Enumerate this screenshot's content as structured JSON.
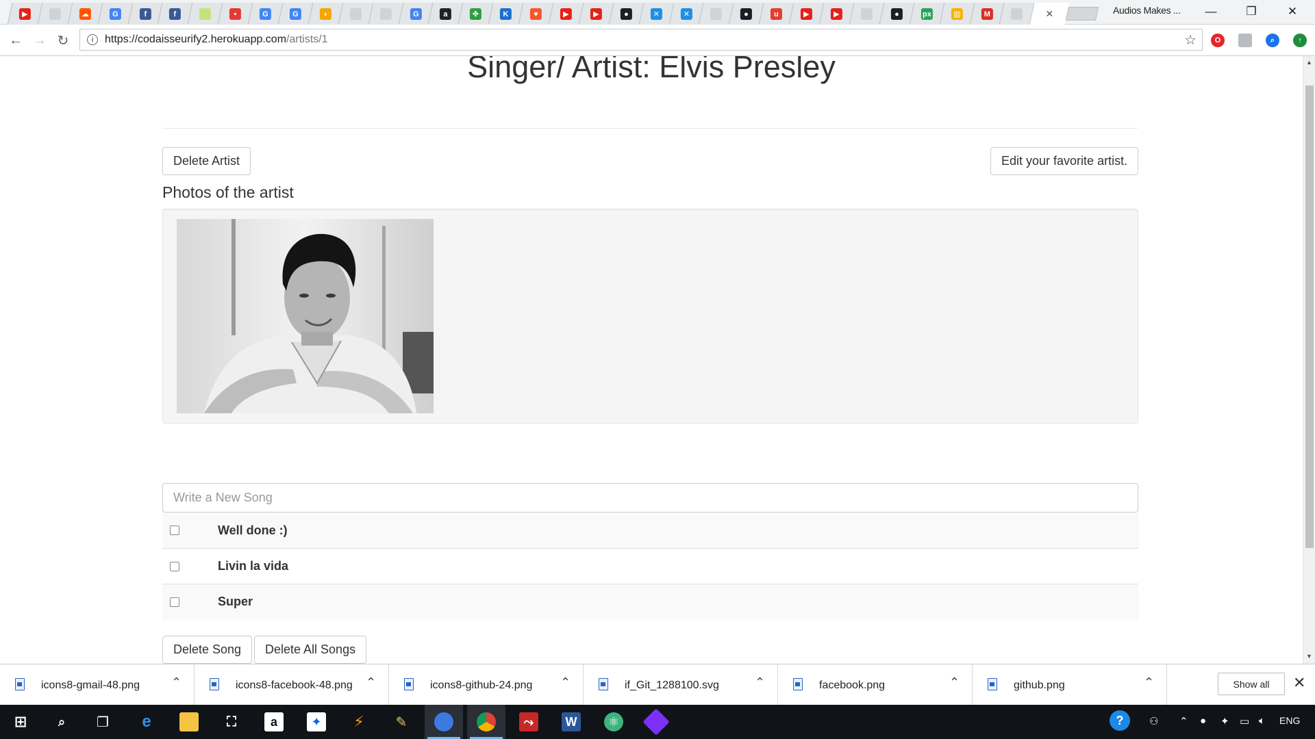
{
  "browser": {
    "tabs": [
      {
        "icon": "youtube-icon",
        "color": "#e62117",
        "glyph": "▶"
      },
      {
        "icon": "page-icon",
        "color": "#cfd3d6",
        "glyph": ""
      },
      {
        "icon": "soundcloud-icon",
        "color": "#ff5500",
        "glyph": "☁"
      },
      {
        "icon": "google-icon",
        "color": "#4285f4",
        "glyph": "G"
      },
      {
        "icon": "facebook-icon",
        "color": "#3b5998",
        "glyph": "f"
      },
      {
        "icon": "facebook-icon",
        "color": "#3b5998",
        "glyph": "f"
      },
      {
        "icon": "circle-icon",
        "color": "#c6e27a",
        "glyph": ""
      },
      {
        "icon": "record-icon",
        "color": "#e53935",
        "glyph": "•"
      },
      {
        "icon": "google-icon",
        "color": "#4285f4",
        "glyph": "G"
      },
      {
        "icon": "google-icon",
        "color": "#4285f4",
        "glyph": "G"
      },
      {
        "icon": "chromecast-icon",
        "color": "#f2a600",
        "glyph": "◗"
      },
      {
        "icon": "page-icon",
        "color": "#cfd3d6",
        "glyph": ""
      },
      {
        "icon": "page-icon",
        "color": "#cfd3d6",
        "glyph": ""
      },
      {
        "icon": "google-icon",
        "color": "#4285f4",
        "glyph": "G"
      },
      {
        "icon": "amazon-icon",
        "color": "#222222",
        "glyph": "a"
      },
      {
        "icon": "clover-icon",
        "color": "#2e9e44",
        "glyph": "✤"
      },
      {
        "icon": "k-icon",
        "color": "#1b6fd1",
        "glyph": "K"
      },
      {
        "icon": "brave-icon",
        "color": "#fb542b",
        "glyph": "♥"
      },
      {
        "icon": "youtube-icon",
        "color": "#e62117",
        "glyph": "▶"
      },
      {
        "icon": "youtube-icon",
        "color": "#e62117",
        "glyph": "▶"
      },
      {
        "icon": "github-icon",
        "color": "#1b1f23",
        "glyph": "●"
      },
      {
        "icon": "x-icon",
        "color": "#1f8fe6",
        "glyph": "✕"
      },
      {
        "icon": "x-icon",
        "color": "#1f8fe6",
        "glyph": "✕"
      },
      {
        "icon": "page-icon",
        "color": "#cfd3d6",
        "glyph": ""
      },
      {
        "icon": "github-icon",
        "color": "#1b1f23",
        "glyph": "●"
      },
      {
        "icon": "udemy-icon",
        "color": "#e63c2e",
        "glyph": "u"
      },
      {
        "icon": "youtube-icon",
        "color": "#e62117",
        "glyph": "▶"
      },
      {
        "icon": "youtube-icon",
        "color": "#e62117",
        "glyph": "▶"
      },
      {
        "icon": "page-icon",
        "color": "#cfd3d6",
        "glyph": ""
      },
      {
        "icon": "github-icon",
        "color": "#1b1f23",
        "glyph": "●"
      },
      {
        "icon": "px-icon",
        "color": "#29a35a",
        "glyph": "px"
      },
      {
        "icon": "bag-icon",
        "color": "#f5b400",
        "glyph": "▥"
      },
      {
        "icon": "gmail-icon",
        "color": "#d93025",
        "glyph": "M"
      },
      {
        "icon": "page-icon",
        "color": "#cfd3d6",
        "glyph": ""
      }
    ],
    "profile_label": "Audios Makes ...",
    "url_host": "https://codaisseurify2.herokuapp.com",
    "url_path": "/artists/1"
  },
  "page": {
    "title": "Singer/ Artist: Elvis Presley",
    "delete_artist_label": "Delete Artist",
    "edit_artist_label": "Edit your favorite artist.",
    "photos_heading": "Photos of the artist",
    "song_input_placeholder": "Write a New Song",
    "songs": [
      {
        "name": "Well done :)"
      },
      {
        "name": "Livin la vida"
      },
      {
        "name": "Super"
      }
    ],
    "delete_song_label": "Delete Song",
    "delete_all_songs_label": "Delete All Songs"
  },
  "downloads": {
    "items": [
      {
        "name": "icons8-gmail-48.png"
      },
      {
        "name": "icons8-facebook-48.png"
      },
      {
        "name": "icons8-github-24.png"
      },
      {
        "name": "if_Git_1288100.svg"
      },
      {
        "name": "facebook.png"
      },
      {
        "name": "github.png"
      }
    ],
    "show_all_label": "Show all"
  },
  "taskbar": {
    "language": "ENG"
  }
}
